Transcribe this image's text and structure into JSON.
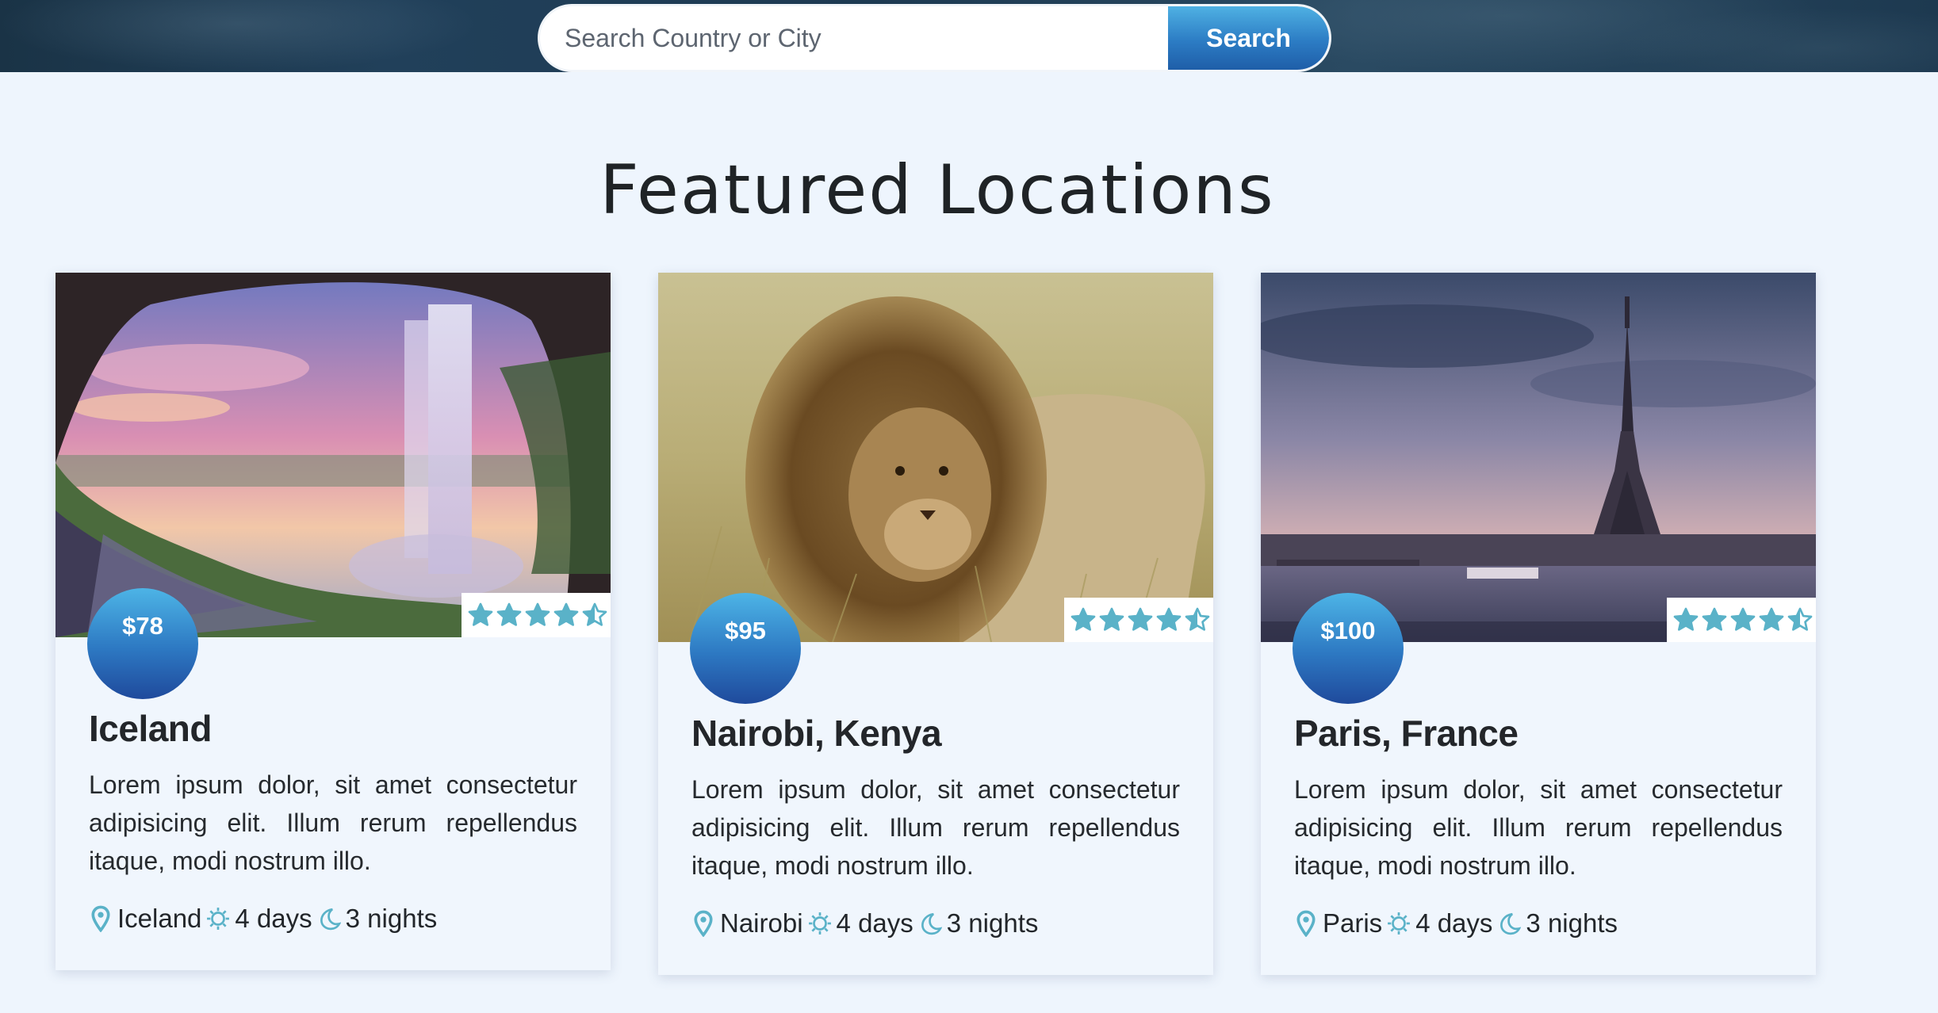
{
  "search": {
    "placeholder": "Search Country or City",
    "button_label": "Search"
  },
  "section": {
    "title": "Featured Locations"
  },
  "colors": {
    "accent": "#2d7cc4",
    "icon": "#5ab2c8",
    "background": "#eef5fd"
  },
  "cards": [
    {
      "title": "Iceland",
      "price": "$78",
      "rating": 4.5,
      "description": "Lorem ipsum dolor, sit amet consectetur adipisicing elit. Illum rerum repellendus itaque, modi nostrum illo.",
      "location": "Iceland",
      "days": "4 days",
      "nights": "3 nights",
      "image": "waterfall-cave-sunset"
    },
    {
      "title": "Nairobi, Kenya",
      "price": "$95",
      "rating": 4.5,
      "description": "Lorem ipsum dolor, sit amet consectetur adipisicing elit. Illum rerum repellendus itaque, modi nostrum illo.",
      "location": "Nairobi",
      "days": "4 days",
      "nights": "3 nights",
      "image": "lion-in-grass"
    },
    {
      "title": "Paris, France",
      "price": "$100",
      "rating": 4.5,
      "description": "Lorem ipsum dolor, sit amet consectetur adipisicing elit. Illum rerum repellendus itaque, modi nostrum illo.",
      "location": "Paris",
      "days": "4 days",
      "nights": "3 nights",
      "image": "eiffel-tower-seine"
    }
  ]
}
